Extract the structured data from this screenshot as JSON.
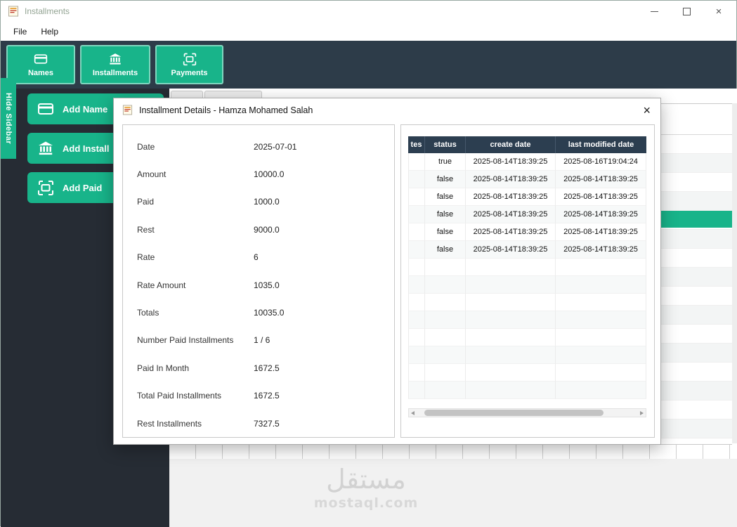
{
  "colors": {
    "accent": "#18b48a",
    "toolbar_bg": "#2d3c49",
    "sidebar_bg": "#262c34",
    "table_header_bg": "#2c3e50"
  },
  "window": {
    "title": "Installments",
    "menu": [
      {
        "label": "File"
      },
      {
        "label": "Help"
      }
    ],
    "controls": {
      "close": "×"
    }
  },
  "toolbar": {
    "buttons": [
      {
        "label": "Names",
        "icon": "credit-card-icon"
      },
      {
        "label": "Installments",
        "icon": "bank-icon"
      },
      {
        "label": "Payments",
        "icon": "payment-card-icon"
      }
    ]
  },
  "sidebar": {
    "hide_label": "Hide Sidebar",
    "buttons": [
      {
        "label": "Add Name",
        "icon": "credit-card-icon"
      },
      {
        "label": "Add Install",
        "icon": "bank-icon"
      },
      {
        "label": "Add Paid",
        "icon": "payment-card-icon"
      }
    ]
  },
  "dialog": {
    "title": "Installment Details - Hamza Mohamed Salah",
    "close": "×",
    "details": [
      {
        "label": "Date",
        "value": "2025-07-01"
      },
      {
        "label": "Amount",
        "value": "10000.0"
      },
      {
        "label": "Paid",
        "value": "1000.0"
      },
      {
        "label": "Rest",
        "value": "9000.0"
      },
      {
        "label": "Rate",
        "value": "6"
      },
      {
        "label": "Rate Amount",
        "value": "1035.0"
      },
      {
        "label": "Totals",
        "value": "10035.0"
      },
      {
        "label": "Number Paid Installments",
        "value": "1 / 6"
      },
      {
        "label": "Paid In Month",
        "value": "1672.5"
      },
      {
        "label": "Total Paid Installments",
        "value": "1672.5"
      },
      {
        "label": "Rest Installments",
        "value": "7327.5"
      }
    ],
    "table": {
      "headers": [
        "tes",
        "status",
        "create date",
        "last modified date"
      ],
      "rows": [
        {
          "notes": "",
          "status": "true",
          "create_date": "2025-08-14T18:39:25",
          "last_modified_date": "2025-08-16T19:04:24"
        },
        {
          "notes": "",
          "status": "false",
          "create_date": "2025-08-14T18:39:25",
          "last_modified_date": "2025-08-14T18:39:25"
        },
        {
          "notes": "",
          "status": "false",
          "create_date": "2025-08-14T18:39:25",
          "last_modified_date": "2025-08-14T18:39:25"
        },
        {
          "notes": "",
          "status": "false",
          "create_date": "2025-08-14T18:39:25",
          "last_modified_date": "2025-08-14T18:39:25"
        },
        {
          "notes": "",
          "status": "false",
          "create_date": "2025-08-14T18:39:25",
          "last_modified_date": "2025-08-14T18:39:25"
        },
        {
          "notes": "",
          "status": "false",
          "create_date": "2025-08-14T18:39:25",
          "last_modified_date": "2025-08-14T18:39:25"
        }
      ]
    }
  },
  "watermark": {
    "line1": "مستقل",
    "line2": "mostaql.com"
  }
}
